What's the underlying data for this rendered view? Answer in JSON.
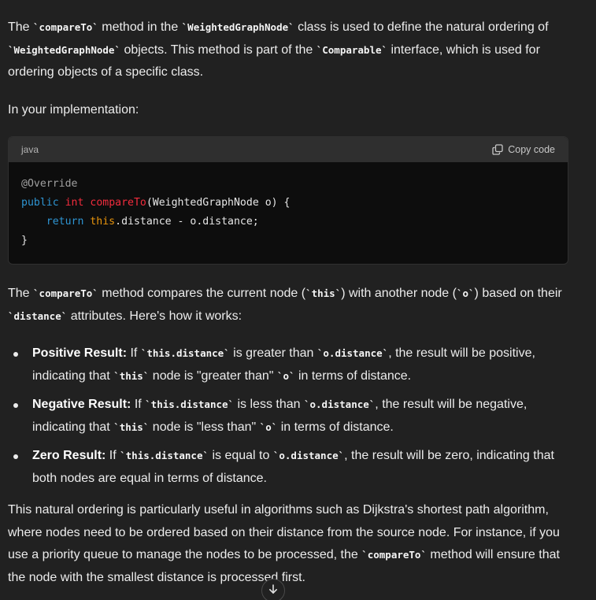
{
  "p1": {
    "t1": "The ",
    "c1": "`compareTo`",
    "t2": " method in the ",
    "c2": "`WeightedGraphNode`",
    "t3": " class is used to define the natural ordering of ",
    "c3": "`WeightedGraphNode`",
    "t4": " objects. This method is part of the ",
    "c4": "`Comparable`",
    "t5": " interface, which is used for ordering objects of a specific class."
  },
  "p2": "In your implementation:",
  "code": {
    "language": "java",
    "copy_label": "Copy code",
    "l1": "@Override",
    "l2_kw1": "public",
    "l2_kw2": "int",
    "l2_fn": "compareTo",
    "l2_rest": "(WeightedGraphNode o) {",
    "l3_indent": "    ",
    "l3_kw": "return",
    "l3_this": "this",
    "l3_rest": ".distance - o.distance;",
    "l4": "}"
  },
  "p3": {
    "t1": "The ",
    "c1": "`compareTo`",
    "t2": " method compares the current node (",
    "c2": "`this`",
    "t3": ") with another node (",
    "c3": "`o`",
    "t4": ") based on their ",
    "c4": "`distance`",
    "t5": " attributes. Here's how it works:"
  },
  "bullets": [
    {
      "label": "Positive Result:",
      "t1": " If ",
      "c1": "`this.distance`",
      "t2": " is greater than ",
      "c2": "`o.distance`",
      "t3": ", the result will be positive, indicating that ",
      "c3": "`this`",
      "t4": " node is \"greater than\" ",
      "c4": "`o`",
      "t5": " in terms of distance."
    },
    {
      "label": "Negative Result:",
      "t1": " If ",
      "c1": "`this.distance`",
      "t2": " is less than ",
      "c2": "`o.distance`",
      "t3": ", the result will be negative, indicating that ",
      "c3": "`this`",
      "t4": " node is \"less than\" ",
      "c4": "`o`",
      "t5": " in terms of distance."
    },
    {
      "label": "Zero Result:",
      "t1": " If ",
      "c1": "`this.distance`",
      "t2": " is equal to ",
      "c2": "`o.distance`",
      "t3": ", the result will be zero, indicating that both nodes are equal in terms of distance."
    }
  ],
  "p4": {
    "t1": "This natural ordering is particularly useful in algorithms such as Dijkstra's shortest path algorithm, where nodes need to be ordered based on their distance from the source node. For instance, if you use a priority queue to manage the nodes to be processed, the ",
    "c1": "`compareTo`",
    "t2": " method will ensure that the node with the smallest distance is processed first."
  },
  "icons": {
    "copy": "copy-icon",
    "scroll": "arrow-down-icon"
  },
  "colors": {
    "background": "#212121",
    "code_bg": "#0d0d0d",
    "code_header_bg": "#2f2f2f",
    "keyword": "#2e95d3",
    "function": "#f22c3d",
    "this_keyword": "#df3079"
  }
}
